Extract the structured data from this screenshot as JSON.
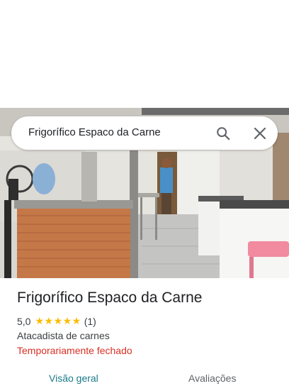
{
  "search": {
    "query": "Frigorífico Espaco da Carne",
    "search_icon": "search-icon",
    "close_icon": "close-icon"
  },
  "place": {
    "name": "Frigorífico Espaco da Carne",
    "rating": "5,0",
    "stars": "★★★★★",
    "review_count": "(1)",
    "category": "Atacadista de carnes",
    "status": "Temporariamente fechado"
  },
  "tabs": [
    {
      "label": "Visão geral",
      "selected": true
    },
    {
      "label": "Avaliações",
      "selected": false
    }
  ],
  "colors": {
    "star": "#fbbc04",
    "status_closed": "#d93025",
    "tab_active": "#1a7a8a"
  }
}
